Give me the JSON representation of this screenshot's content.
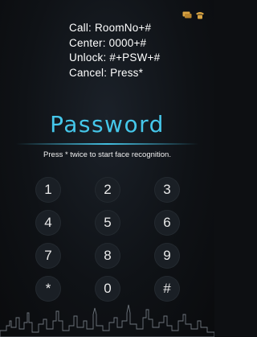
{
  "instructions": {
    "call": "Call: RoomNo+#",
    "center": "Center: 0000+#",
    "unlock": "Unlock: #+PSW+#",
    "cancel": "Cancel: Press*"
  },
  "title": "Password",
  "hint": "Press * twice to start face recognition.",
  "keypad": [
    "1",
    "2",
    "3",
    "4",
    "5",
    "6",
    "7",
    "8",
    "9",
    "*",
    "0",
    "#"
  ],
  "colors": {
    "accent": "#45c7ea",
    "status_icon": "#d9a443"
  },
  "icons": [
    "chat-icon",
    "phone-icon",
    "city-skyline-icon"
  ]
}
